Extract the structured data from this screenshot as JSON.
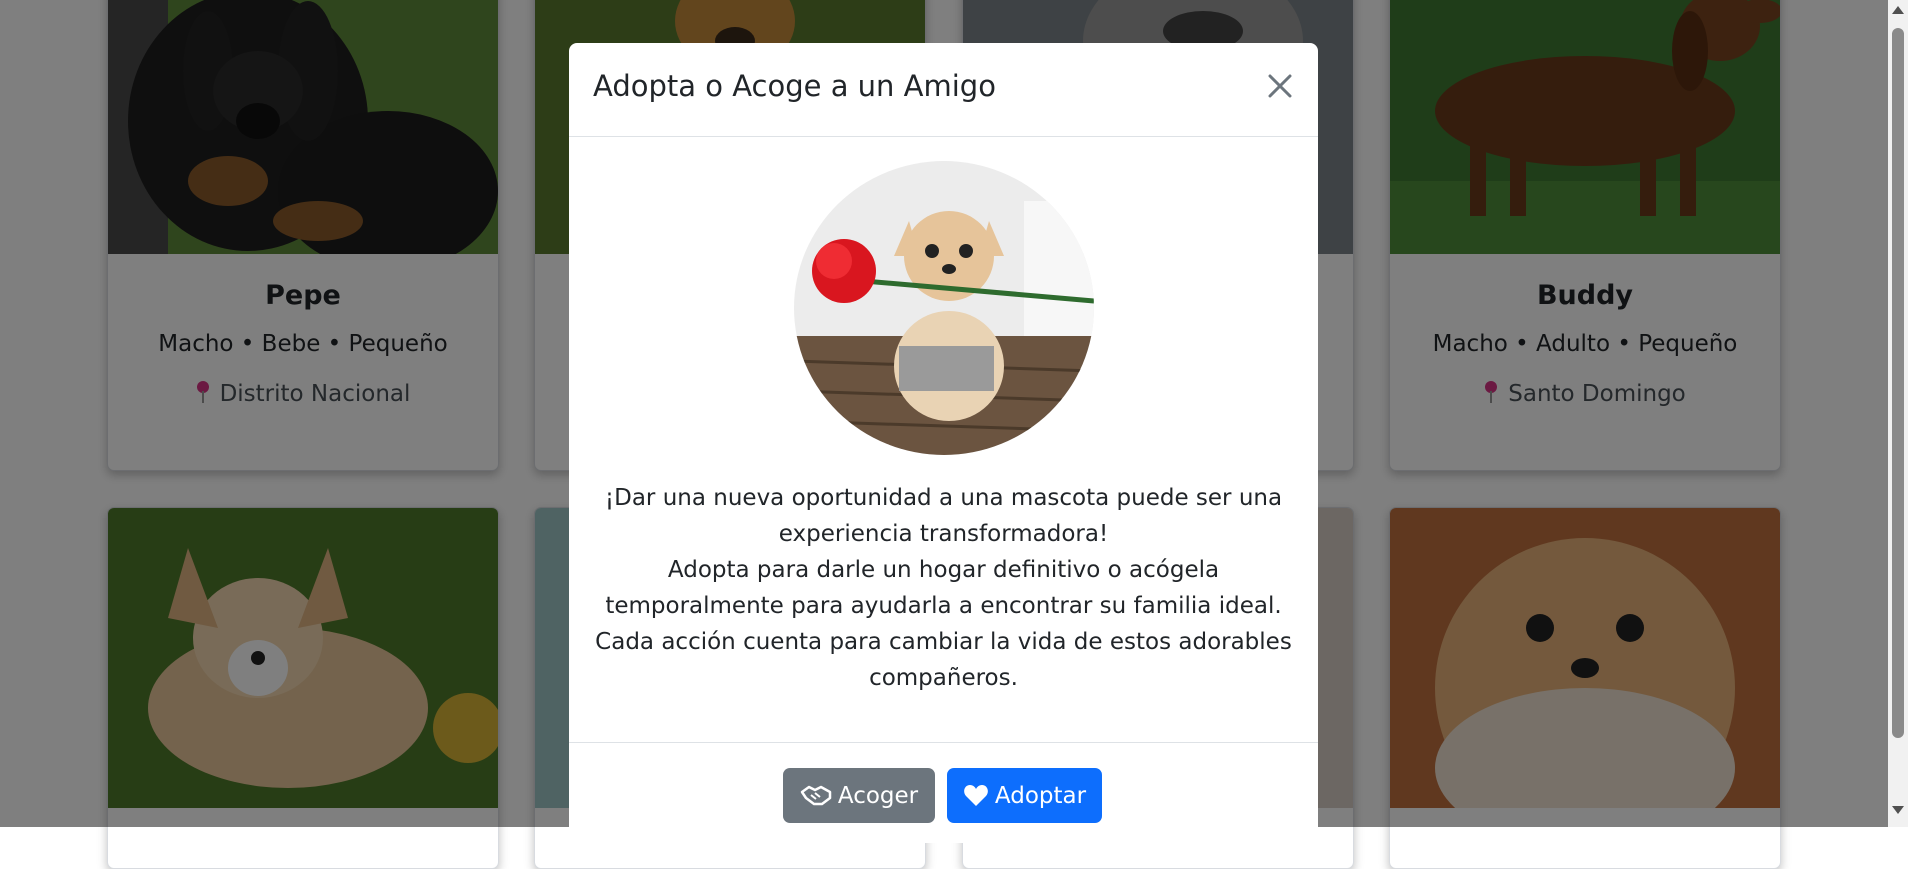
{
  "cards": [
    {
      "name": "Pepe",
      "meta": "Macho • Bebe • Pequeño",
      "location": "Distrito Nacional"
    },
    {
      "name": "Buddy",
      "meta": "Macho • Adulto • Pequeño",
      "location": "Santo Domingo"
    }
  ],
  "modal": {
    "title": "Adopta o Acoge a un Amigo",
    "paragraphs": [
      "¡Dar una nueva oportunidad a una mascota puede ser una experiencia transformadora!",
      "Adopta para darle un hogar definitivo o acógela temporalmente para ayudarla a encontrar su familia ideal.",
      "Cada acción cuenta para cambiar la vida de estos adorables compañeros."
    ],
    "buttons": {
      "foster": "Acoger",
      "adopt": "Adoptar"
    }
  },
  "icons": {
    "close": "close-icon",
    "pin": "map-pin-icon",
    "foster": "handshake-icon",
    "adopt": "heart-icon"
  },
  "colors": {
    "primary": "#0d6efd",
    "secondary": "#6c757d",
    "pin": "#d63384"
  }
}
